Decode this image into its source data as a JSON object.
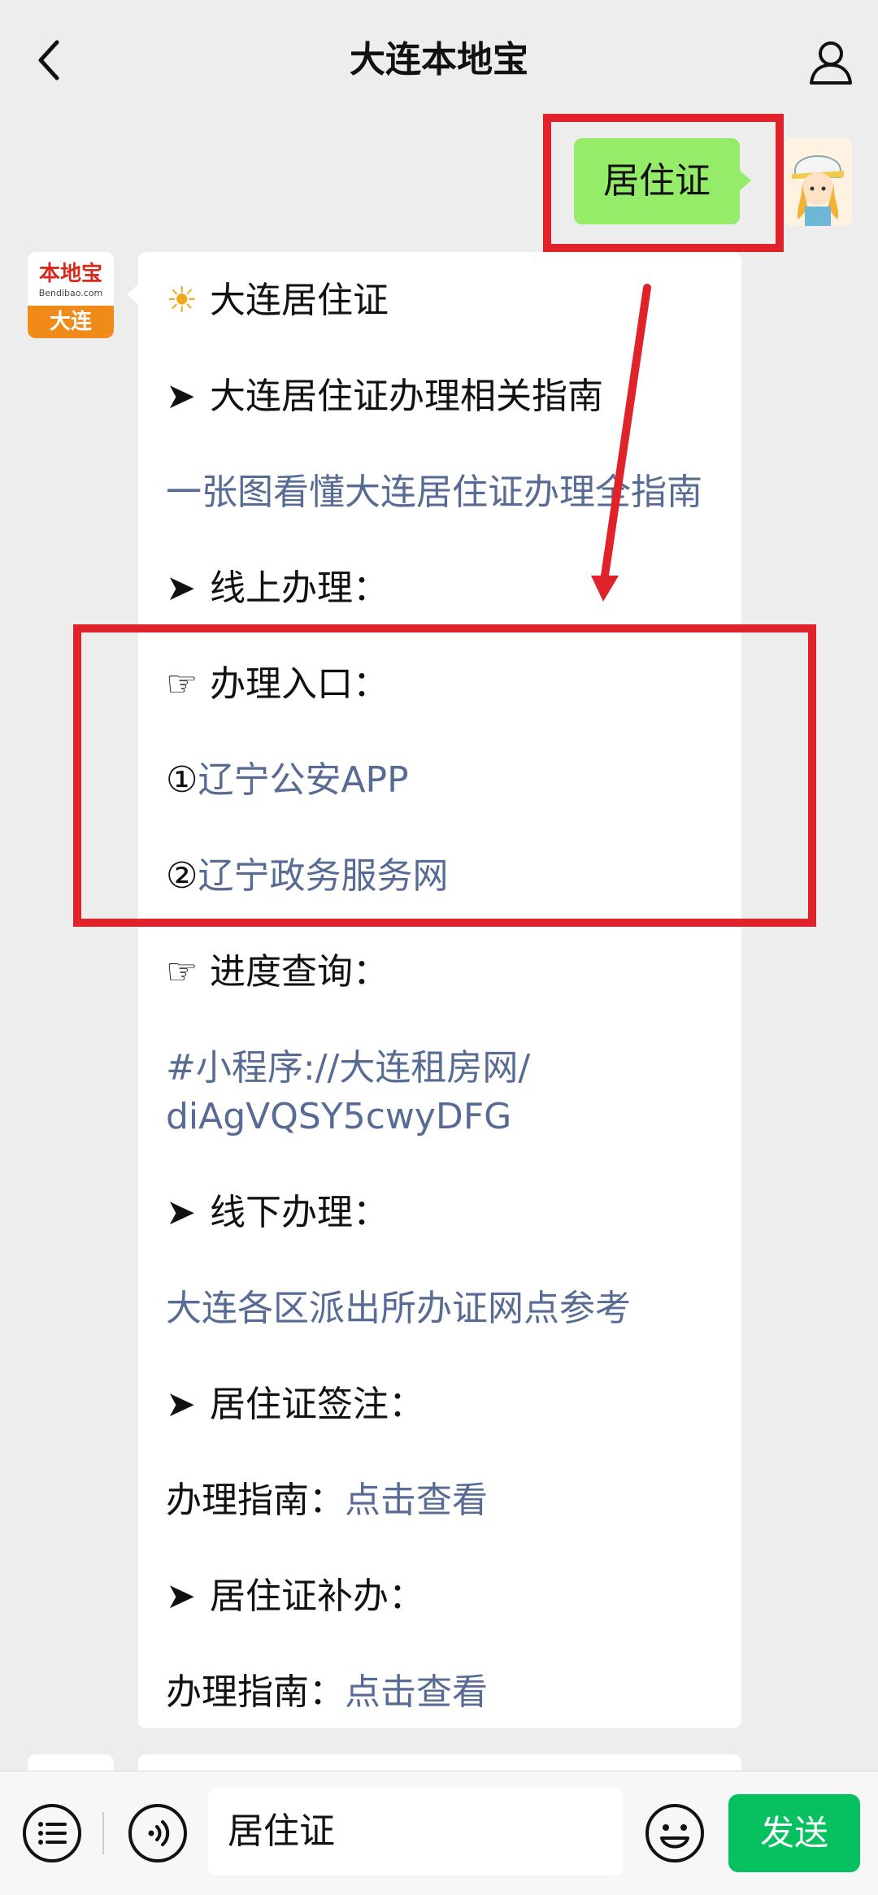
{
  "header": {
    "title": "大连本地宝",
    "back_icon": "chevron-left-icon",
    "profile_icon": "person-icon"
  },
  "outgoing_message": {
    "text": "居住证",
    "bubble_color": "#95ec69"
  },
  "bot_avatar": {
    "logo_text": "本地宝",
    "logo_sub": "Bendibao.com",
    "city": "大连"
  },
  "incoming_message": {
    "line_title": "大连居住证",
    "line_guide_heading": "大连居住证办理相关指南",
    "line_guide_link": "一张图看懂大连居住证办理全指南",
    "line_online_heading": "线上办理：",
    "line_entry_heading": "办理入口：",
    "line_entry_1_num": "①",
    "line_entry_1": "辽宁公安APP",
    "line_entry_2_num": "②",
    "line_entry_2": "辽宁政务服务网",
    "line_progress_heading": "进度查询：",
    "line_progress_link_1": "#小程序://大连租房网/",
    "line_progress_link_2": "diAgVQSY5cwyDFG",
    "line_offline_heading": "线下办理：",
    "line_offline_link": "大连各区派出所办证网点参考",
    "line_sign_heading": "居住证签注：",
    "line_sign_label": "办理指南：",
    "line_sign_link": "点击查看",
    "line_reissue_heading": "居住证补办：",
    "line_reissue_label": "办理指南：",
    "line_reissue_link": "点击查看",
    "link_color": "#576b95"
  },
  "glyphs": {
    "sun": "☀",
    "arrow": "➤",
    "pointer": "☞"
  },
  "input_bar": {
    "menu_icon": "list-menu-icon",
    "voice_icon": "voice-icon",
    "input_value": "居住证",
    "emoji_icon": "emoji-icon",
    "send_label": "发送",
    "send_color": "#07c160"
  },
  "annotation_color": "#e0222a"
}
